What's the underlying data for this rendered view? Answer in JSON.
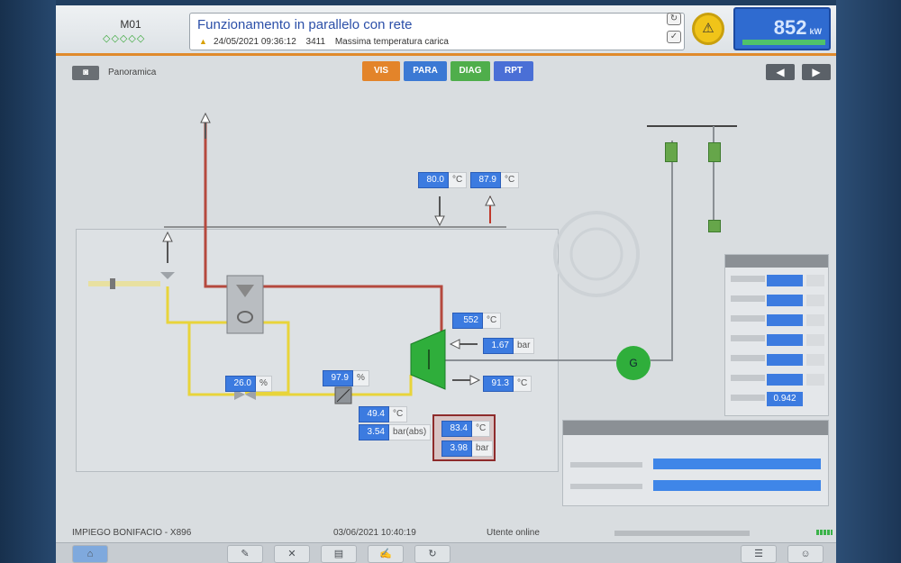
{
  "header": {
    "machine_id": "M01",
    "machine_dots": "◇◇◇◇◇",
    "message_title": "Funzionamento in parallelo con rete",
    "message_date": "24/05/2021 09:36:12",
    "message_code": "3411",
    "message_text": "Massima temperatura carica",
    "power_value": "852",
    "power_unit": "kW",
    "alarm_icon": "warning-triangle-icon"
  },
  "toolbar": {
    "breadcrumb": "Panoramica",
    "tabs": [
      {
        "label": "VIS",
        "color": "#e3842a"
      },
      {
        "label": "PARA",
        "color": "#3b79d4"
      },
      {
        "label": "DIAG",
        "color": "#4fae4b"
      },
      {
        "label": "RPT",
        "color": "#4a6fd6"
      }
    ]
  },
  "diagram": {
    "top_temp_1": {
      "value": "80.0",
      "unit": "°C"
    },
    "top_temp_2": {
      "value": "87.9",
      "unit": "°C"
    },
    "exhaust_temp": {
      "value": "552",
      "unit": "°C"
    },
    "boost_pressure": {
      "value": "1.67",
      "unit": "bar"
    },
    "return_temp": {
      "value": "91.3",
      "unit": "°C"
    },
    "valve_pos": {
      "value": "26.0",
      "unit": "%"
    },
    "cooler_pos": {
      "value": "97.9",
      "unit": "%"
    },
    "oil_temp": {
      "value": "49.4",
      "unit": "°C"
    },
    "oil_pressure": {
      "value": "3.54",
      "unit": "bar(abs)"
    },
    "exhaust_box_temp": {
      "value": "83.4",
      "unit": "°C"
    },
    "exhaust_box_pressure": {
      "value": "3.98",
      "unit": "bar"
    },
    "generator_label": "G",
    "power_factor": "0.942"
  },
  "status": {
    "left_text": "IMPIEGO BONIFACIO - X896",
    "datetime": "03/06/2021 10:40:19",
    "user": "Utente online"
  }
}
